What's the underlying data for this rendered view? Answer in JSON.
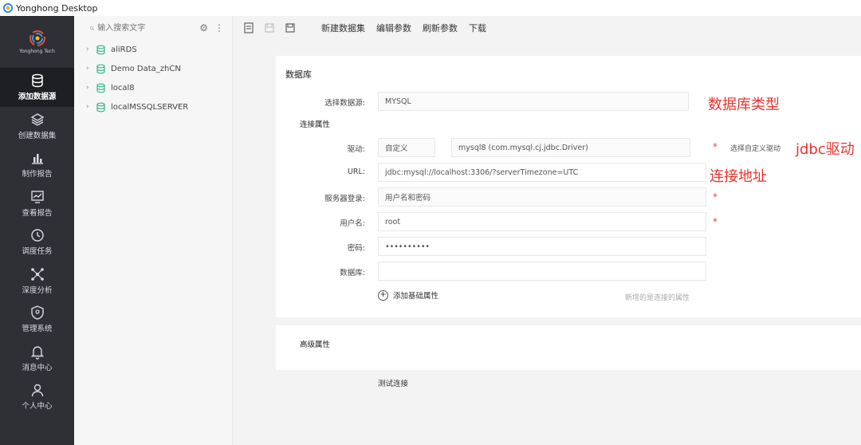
{
  "window": {
    "title": "Yonghong Desktop"
  },
  "brand": {
    "name": "Yonghong Tech"
  },
  "nav": [
    {
      "label": "添加数据源",
      "icon": "database-icon",
      "active": true
    },
    {
      "label": "创建数据集",
      "icon": "stack-icon",
      "active": false
    },
    {
      "label": "制作报告",
      "icon": "bar-chart-icon",
      "active": false
    },
    {
      "label": "查看报告",
      "icon": "line-chart-icon",
      "active": false
    },
    {
      "label": "调度任务",
      "icon": "clock-icon",
      "active": false
    },
    {
      "label": "深度分析",
      "icon": "network-icon",
      "active": false
    },
    {
      "label": "管理系统",
      "icon": "shield-icon",
      "active": false
    },
    {
      "label": "消息中心",
      "icon": "bell-icon",
      "active": false
    },
    {
      "label": "个人中心",
      "icon": "user-icon",
      "active": false
    }
  ],
  "tree": {
    "search_placeholder": "输入搜索文字",
    "items": [
      {
        "label": "aliRDS"
      },
      {
        "label": "Demo Data_zhCN"
      },
      {
        "label": "local8"
      },
      {
        "label": "localMSSQLSERVER"
      }
    ]
  },
  "toolbar": {
    "new_dataset": "新建数据集",
    "edit_params": "编辑参数",
    "refresh_params": "刷新参数",
    "download": "下载"
  },
  "form": {
    "section_database": "数据库",
    "select_source_label": "选择数据源:",
    "select_source_value": "MYSQL",
    "connection_props": "连接属性",
    "driver_label": "驱动:",
    "driver_mode": "自定义",
    "driver_value": "mysql8 (com.mysql.cj.jdbc.Driver)",
    "custom_driver_button": "选择自定义驱动",
    "url_label": "URL:",
    "url_value": "jdbc:mysql://localhost:3306/?serverTimezone=UTC",
    "server_login_label": "服务器登录:",
    "server_login_value": "用户名和密码",
    "username_label": "用户名:",
    "username_value": "root",
    "password_label": "密码:",
    "password_value": "••••••••••",
    "database_label": "数据库:",
    "database_value": "",
    "add_basic_prop": "添加基础属性",
    "hint_text": "新增的是连接的属性",
    "required_mark": "*",
    "section_advanced": "高级属性",
    "test_connection": "测试连接"
  },
  "annotations": {
    "db_type": "数据库类型",
    "jdbc_driver": "jdbc驱动",
    "conn_address": "连接地址"
  },
  "colors": {
    "annotation": "#e8342e",
    "nav_bg": "#2e3036",
    "accent_green": "#3bb58a"
  }
}
